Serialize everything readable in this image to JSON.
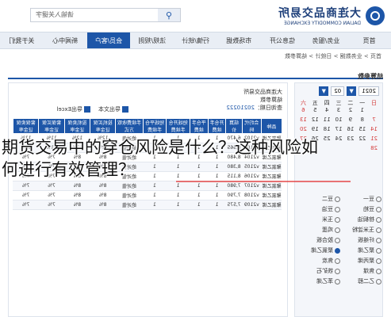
{
  "overlay": {
    "line1": "期货交易中的穿仓风险是什么？这种风险如",
    "line2": "何进行有效管理？"
  },
  "header": {
    "logo_cn": "大连商品交易所",
    "logo_en": "DALIAN COMMODITY EXCHANGE",
    "search_value": "请输入关键字"
  },
  "nav": {
    "items": [
      "首页",
      "业务/服务",
      "信息公开",
      "市场数据",
      "行情/统计",
      "法规/规则",
      "会员/客户",
      "新闻中心",
      "关于我们"
    ]
  },
  "crumb": "首页 > 业务数据 > 日统计 > 结算参数",
  "panel_title": "结算参数",
  "calendar": {
    "year": "2021",
    "month": "02",
    "weekdays": [
      "日",
      "一",
      "二",
      "三",
      "四",
      "五",
      "六"
    ],
    "days": [
      "",
      "1",
      "2",
      "3",
      "4",
      "5",
      "6",
      "7",
      "8",
      "9",
      "10",
      "11",
      "12",
      "13",
      "14",
      "15",
      "16",
      "17",
      "18",
      "19",
      "20",
      "21",
      "22",
      "23",
      "24",
      "25",
      "26",
      "27",
      "28"
    ]
  },
  "varieties": [
    "豆一",
    "豆二",
    "豆粕",
    "豆油",
    "棕榈油",
    "玉米",
    "玉米淀粉",
    "鸡蛋",
    "纤维板",
    "胶合板",
    "聚乙烯",
    "聚氯乙烯",
    "聚丙烯",
    "焦炭",
    "焦煤",
    "铁矿石",
    "乙二醇",
    "苯乙烯"
  ],
  "doc": {
    "org": "大连商品交易所",
    "report": "结算参数",
    "date_label": "查询日期：",
    "date": "20210222",
    "actions": [
      "导出文本",
      "导出Excel"
    ]
  },
  "table": {
    "headers": [
      "品种",
      "合约代码",
      "结算价",
      "开仓手续费",
      "平仓手续费",
      "短线开仓手续费",
      "短线平仓手续费",
      "手续费收取方式",
      "投机买保证金率",
      "投机卖保证金率",
      "套保买保证金率",
      "套保卖保证金率"
    ],
    "rows": [
      [
        "聚氯乙烯",
        "v2102",
        "6,470",
        "1",
        "1",
        "1",
        "1",
        "绝对值",
        "12%",
        "12%",
        "11%",
        "11%"
      ],
      [
        "聚氯乙烯",
        "v2103",
        "8,565",
        "1",
        "1",
        "1",
        "1",
        "绝对值",
        "12%",
        "12%",
        "11%",
        "11%"
      ],
      [
        "聚氯乙烯",
        "v2104",
        "8,480",
        "1",
        "1",
        "1",
        "1",
        "绝对值",
        "8%",
        "8%",
        "7%",
        "7%"
      ],
      [
        "聚氯乙烯",
        "v2105",
        "8,380",
        "1",
        "1",
        "1",
        "1",
        "绝对值",
        "8%",
        "8%",
        "7%",
        "7%"
      ],
      [
        "聚氯乙烯",
        "v2106",
        "8,115",
        "1",
        "1",
        "1",
        "1",
        "绝对值",
        "8%",
        "8%",
        "7%",
        "7%"
      ],
      [
        "聚氯乙烯",
        "v2107",
        "7,980",
        "1",
        "1",
        "1",
        "1",
        "绝对值",
        "8%",
        "8%",
        "7%",
        "7%"
      ],
      [
        "聚氯乙烯",
        "v2108",
        "7,790",
        "1",
        "1",
        "1",
        "1",
        "绝对值",
        "8%",
        "8%",
        "7%",
        "7%"
      ],
      [
        "聚氯乙烯",
        "v2109",
        "7,575",
        "1",
        "1",
        "1",
        "1",
        "绝对值",
        "8%",
        "8%",
        "7%",
        "7%"
      ]
    ]
  },
  "colors": {
    "accent": "#1d56a8",
    "nav_bg": "#e9eef5",
    "highlight": "#e23b3b"
  }
}
